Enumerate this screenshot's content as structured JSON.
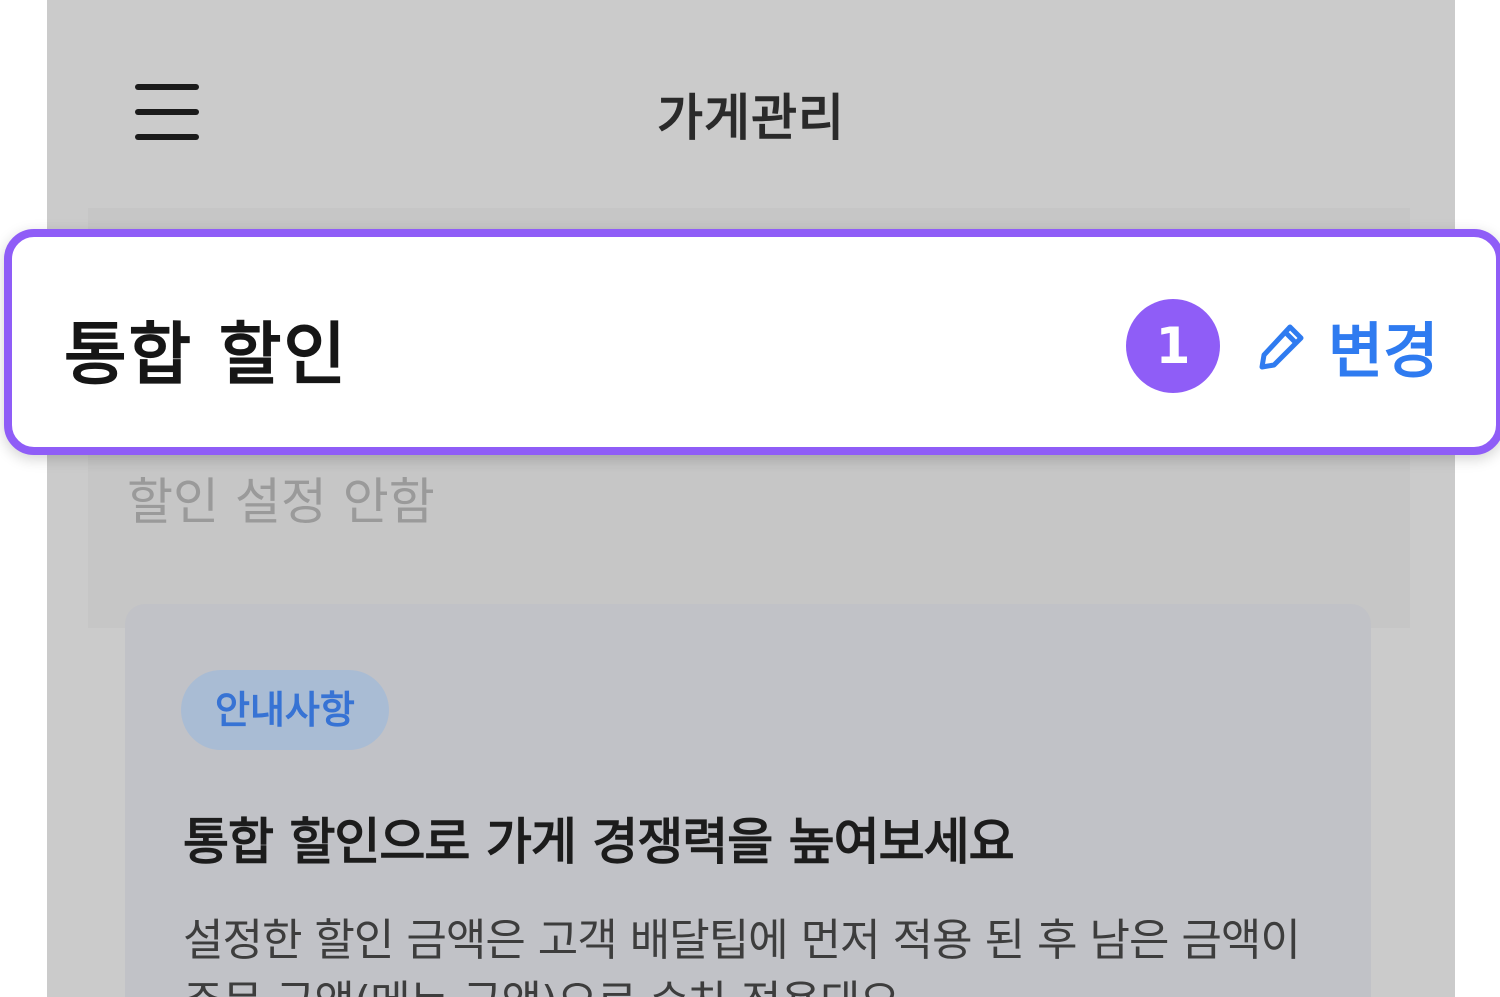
{
  "header": {
    "title": "가게관리",
    "menu_icon": "hamburger-menu-icon"
  },
  "highlight": {
    "title": "통합 할인",
    "step_number": "1",
    "edit_label": "변경",
    "edit_icon": "pencil-icon",
    "accent_color": "#8f5df7",
    "link_color": "#2f7bf0"
  },
  "section": {
    "status": "할인 설정 안함"
  },
  "notice": {
    "badge": "안내사항",
    "title": "통합 할인으로 가게 경쟁력을 높여보세요",
    "body": "설정한 할인 금액은 고객 배달팁에 먼저 적용 된 후 남은 금액이 주문 금액(메뉴 금액)으로 순차 적용돼요"
  }
}
